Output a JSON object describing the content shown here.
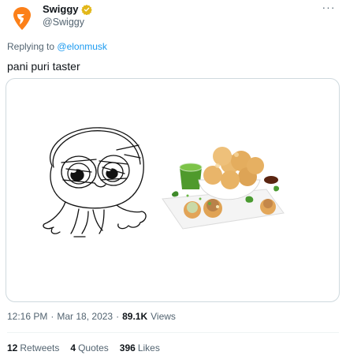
{
  "author": {
    "display_name": "Swiggy",
    "handle": "@Swiggy",
    "verified": true,
    "avatar_icon": "swiggy-logo-icon",
    "brand_color": "#fc8019",
    "badge_color": "#e2b719"
  },
  "more_icon": "more-horizontal-icon",
  "more_label": "···",
  "reply_context": {
    "prefix": "Replying to",
    "mention": "@elonmusk"
  },
  "tweet": {
    "text": "pani puri taster"
  },
  "media": {
    "alt": "pani-puri-image",
    "description_icons": [
      "doodle-character-icon",
      "pani-puri-plate-icon"
    ]
  },
  "meta": {
    "time": "12:16 PM",
    "separator": "·",
    "date": "Mar 18, 2023",
    "separator2": "·",
    "views_count": "89.1K",
    "views_label": "Views"
  },
  "stats": {
    "retweets_count": "12",
    "retweets_label": "Retweets",
    "quotes_count": "4",
    "quotes_label": "Quotes",
    "likes_count": "396",
    "likes_label": "Likes"
  },
  "colors": {
    "text_primary": "#0f1419",
    "text_secondary": "#536471",
    "link": "#1d9bf0",
    "border": "#cfd9de"
  }
}
